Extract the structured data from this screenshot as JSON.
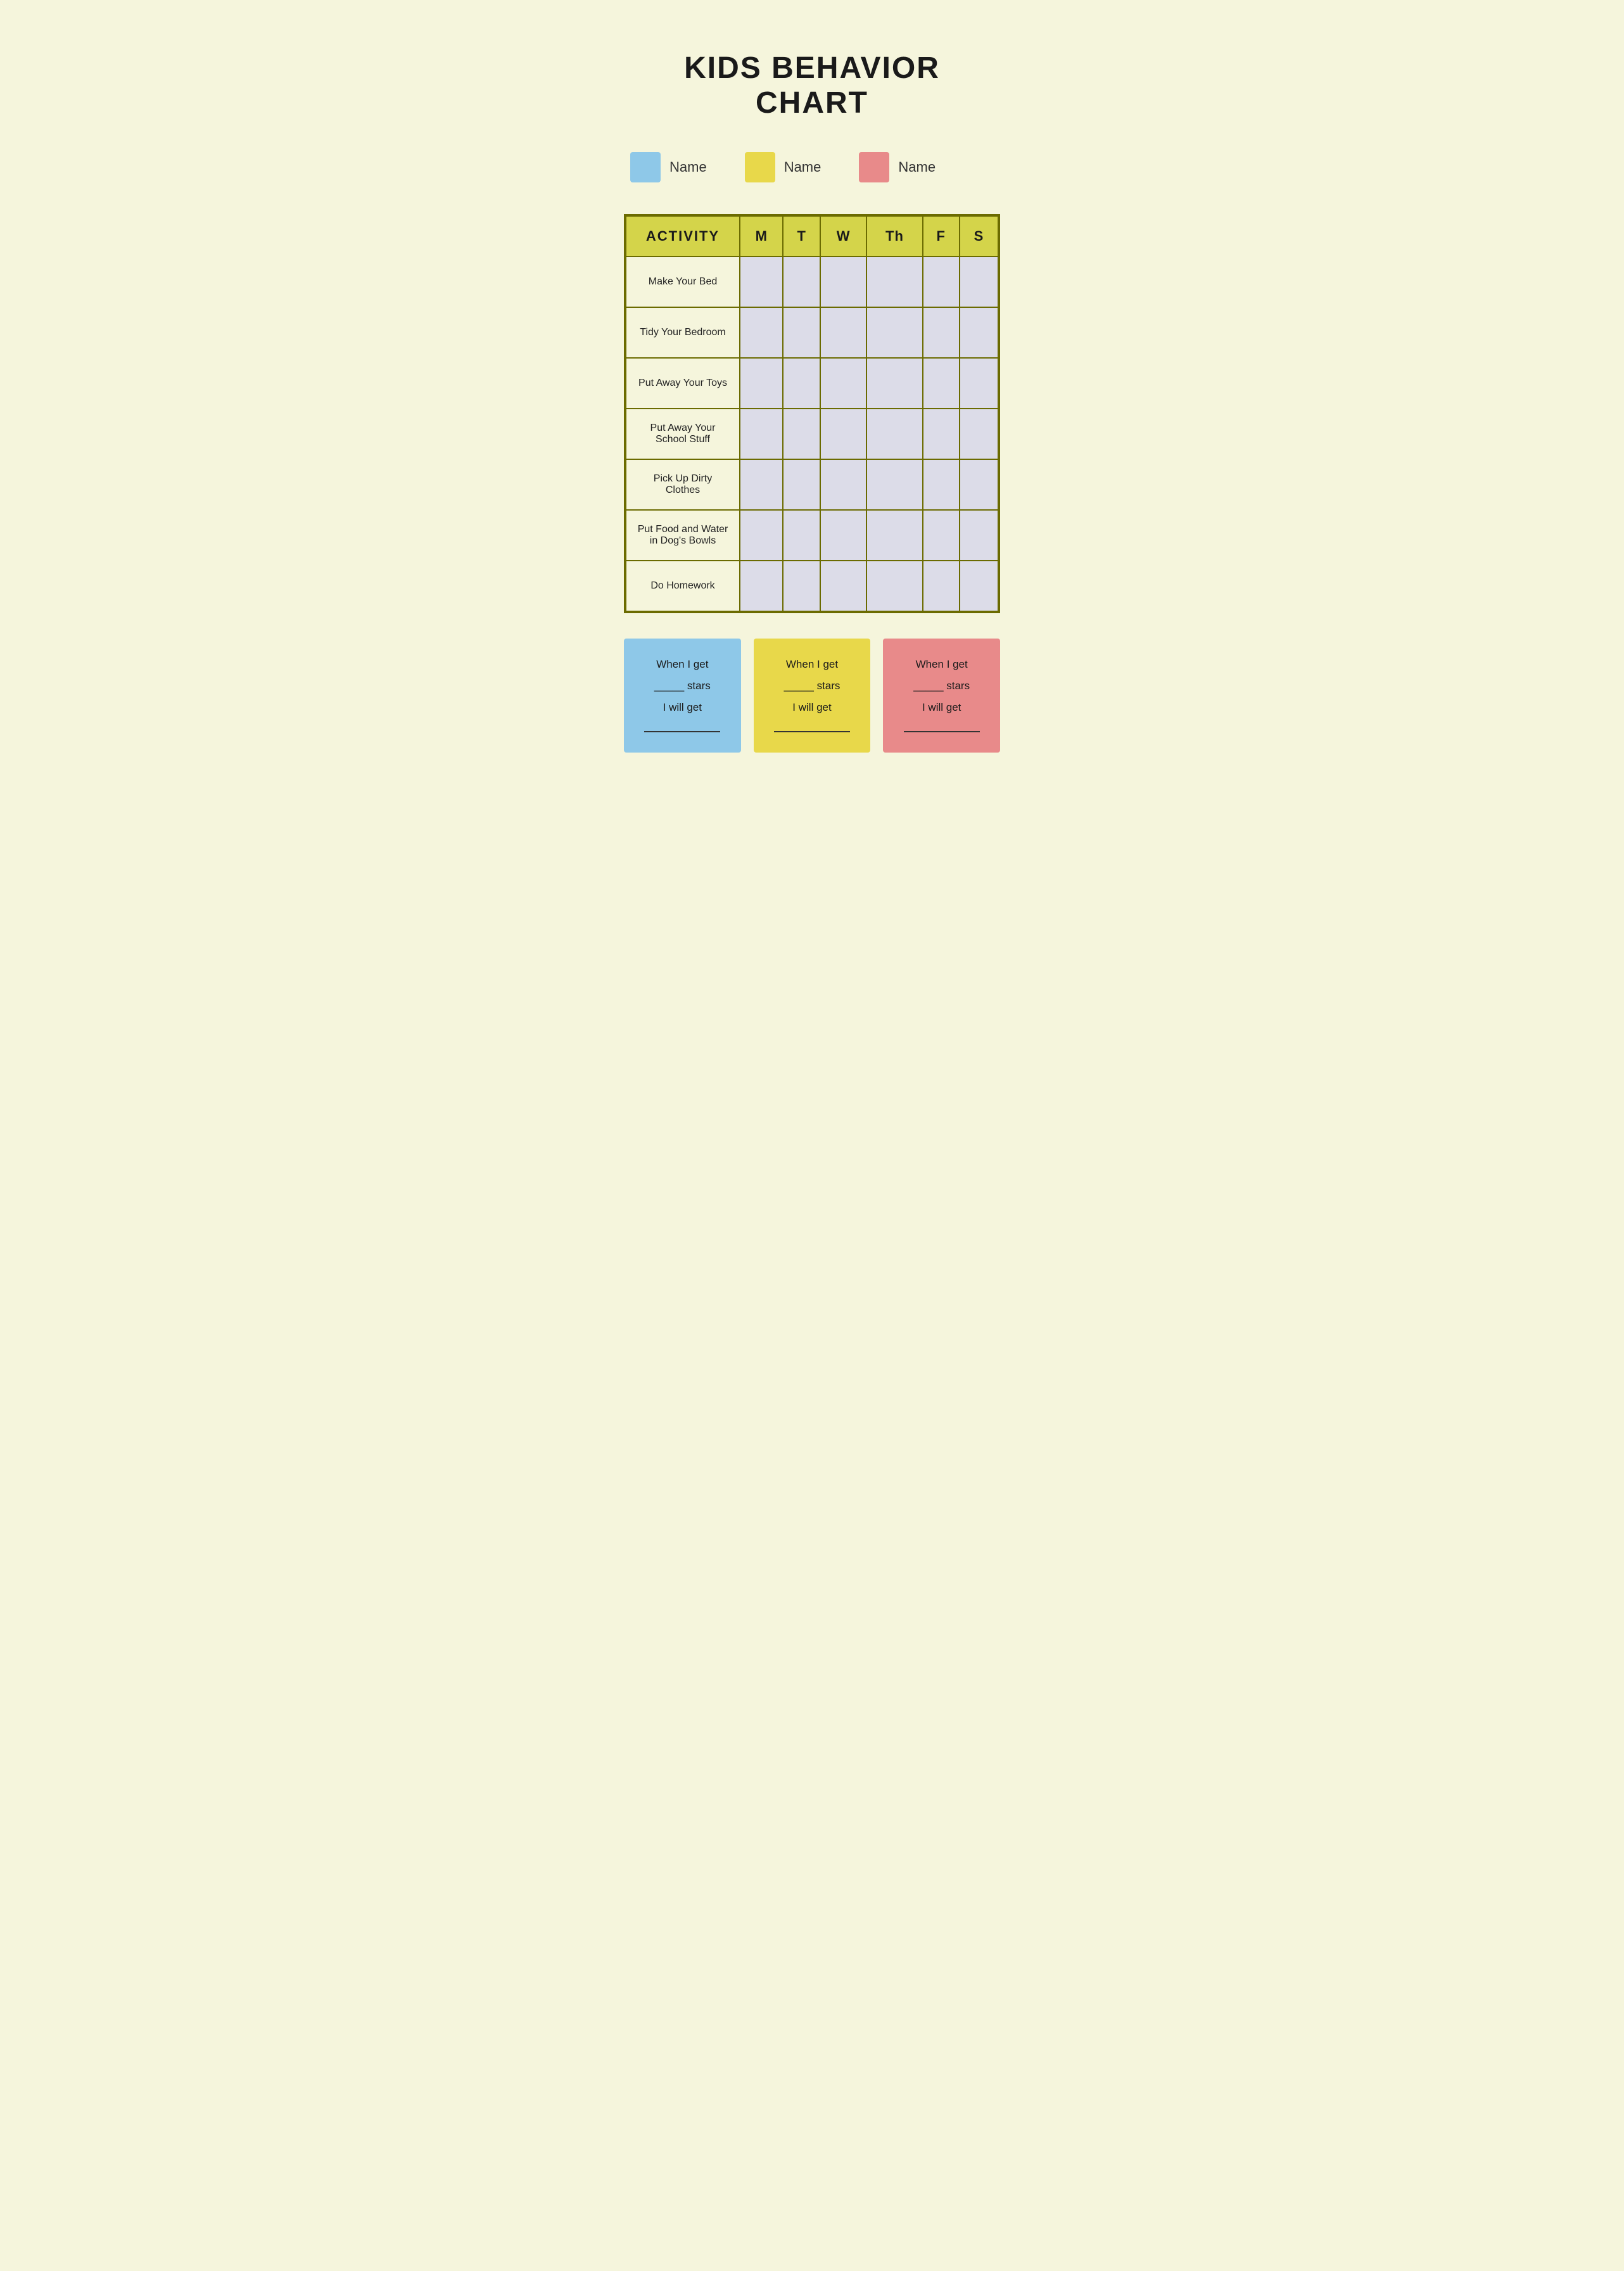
{
  "page": {
    "title": "KIDS BEHAVIOR CHART",
    "background_color": "#f5f5dc"
  },
  "legend": {
    "items": [
      {
        "id": "blue",
        "color": "#8ec8e8",
        "label": "Name"
      },
      {
        "id": "yellow",
        "color": "#e8d84a",
        "label": "Name"
      },
      {
        "id": "pink",
        "color": "#e88a8a",
        "label": "Name"
      }
    ]
  },
  "table": {
    "header": {
      "activity_col": "ACTIVITY",
      "day_cols": [
        "M",
        "T",
        "W",
        "Th",
        "F",
        "S"
      ]
    },
    "rows": [
      {
        "activity": "Make Your Bed"
      },
      {
        "activity": "Tidy Your Bedroom"
      },
      {
        "activity": "Put Away Your Toys"
      },
      {
        "activity": "Put Away Your School Stuff"
      },
      {
        "activity": "Pick Up Dirty Clothes"
      },
      {
        "activity": "Put Food and Water in Dog's Bowls"
      },
      {
        "activity": "Do Homework"
      }
    ]
  },
  "reward_cards": [
    {
      "color": "#8ec8e8",
      "line1": "When I get",
      "line2": "_____ stars",
      "line3": "I will get",
      "line4": "_______________"
    },
    {
      "color": "#e8d84a",
      "line1": "When I get",
      "line2": "_____ stars",
      "line3": "I will get",
      "line4": "_______________"
    },
    {
      "color": "#e88a8a",
      "line1": "When I get",
      "line2": "_____ stars",
      "line3": "I will get",
      "line4": "_______________"
    }
  ]
}
